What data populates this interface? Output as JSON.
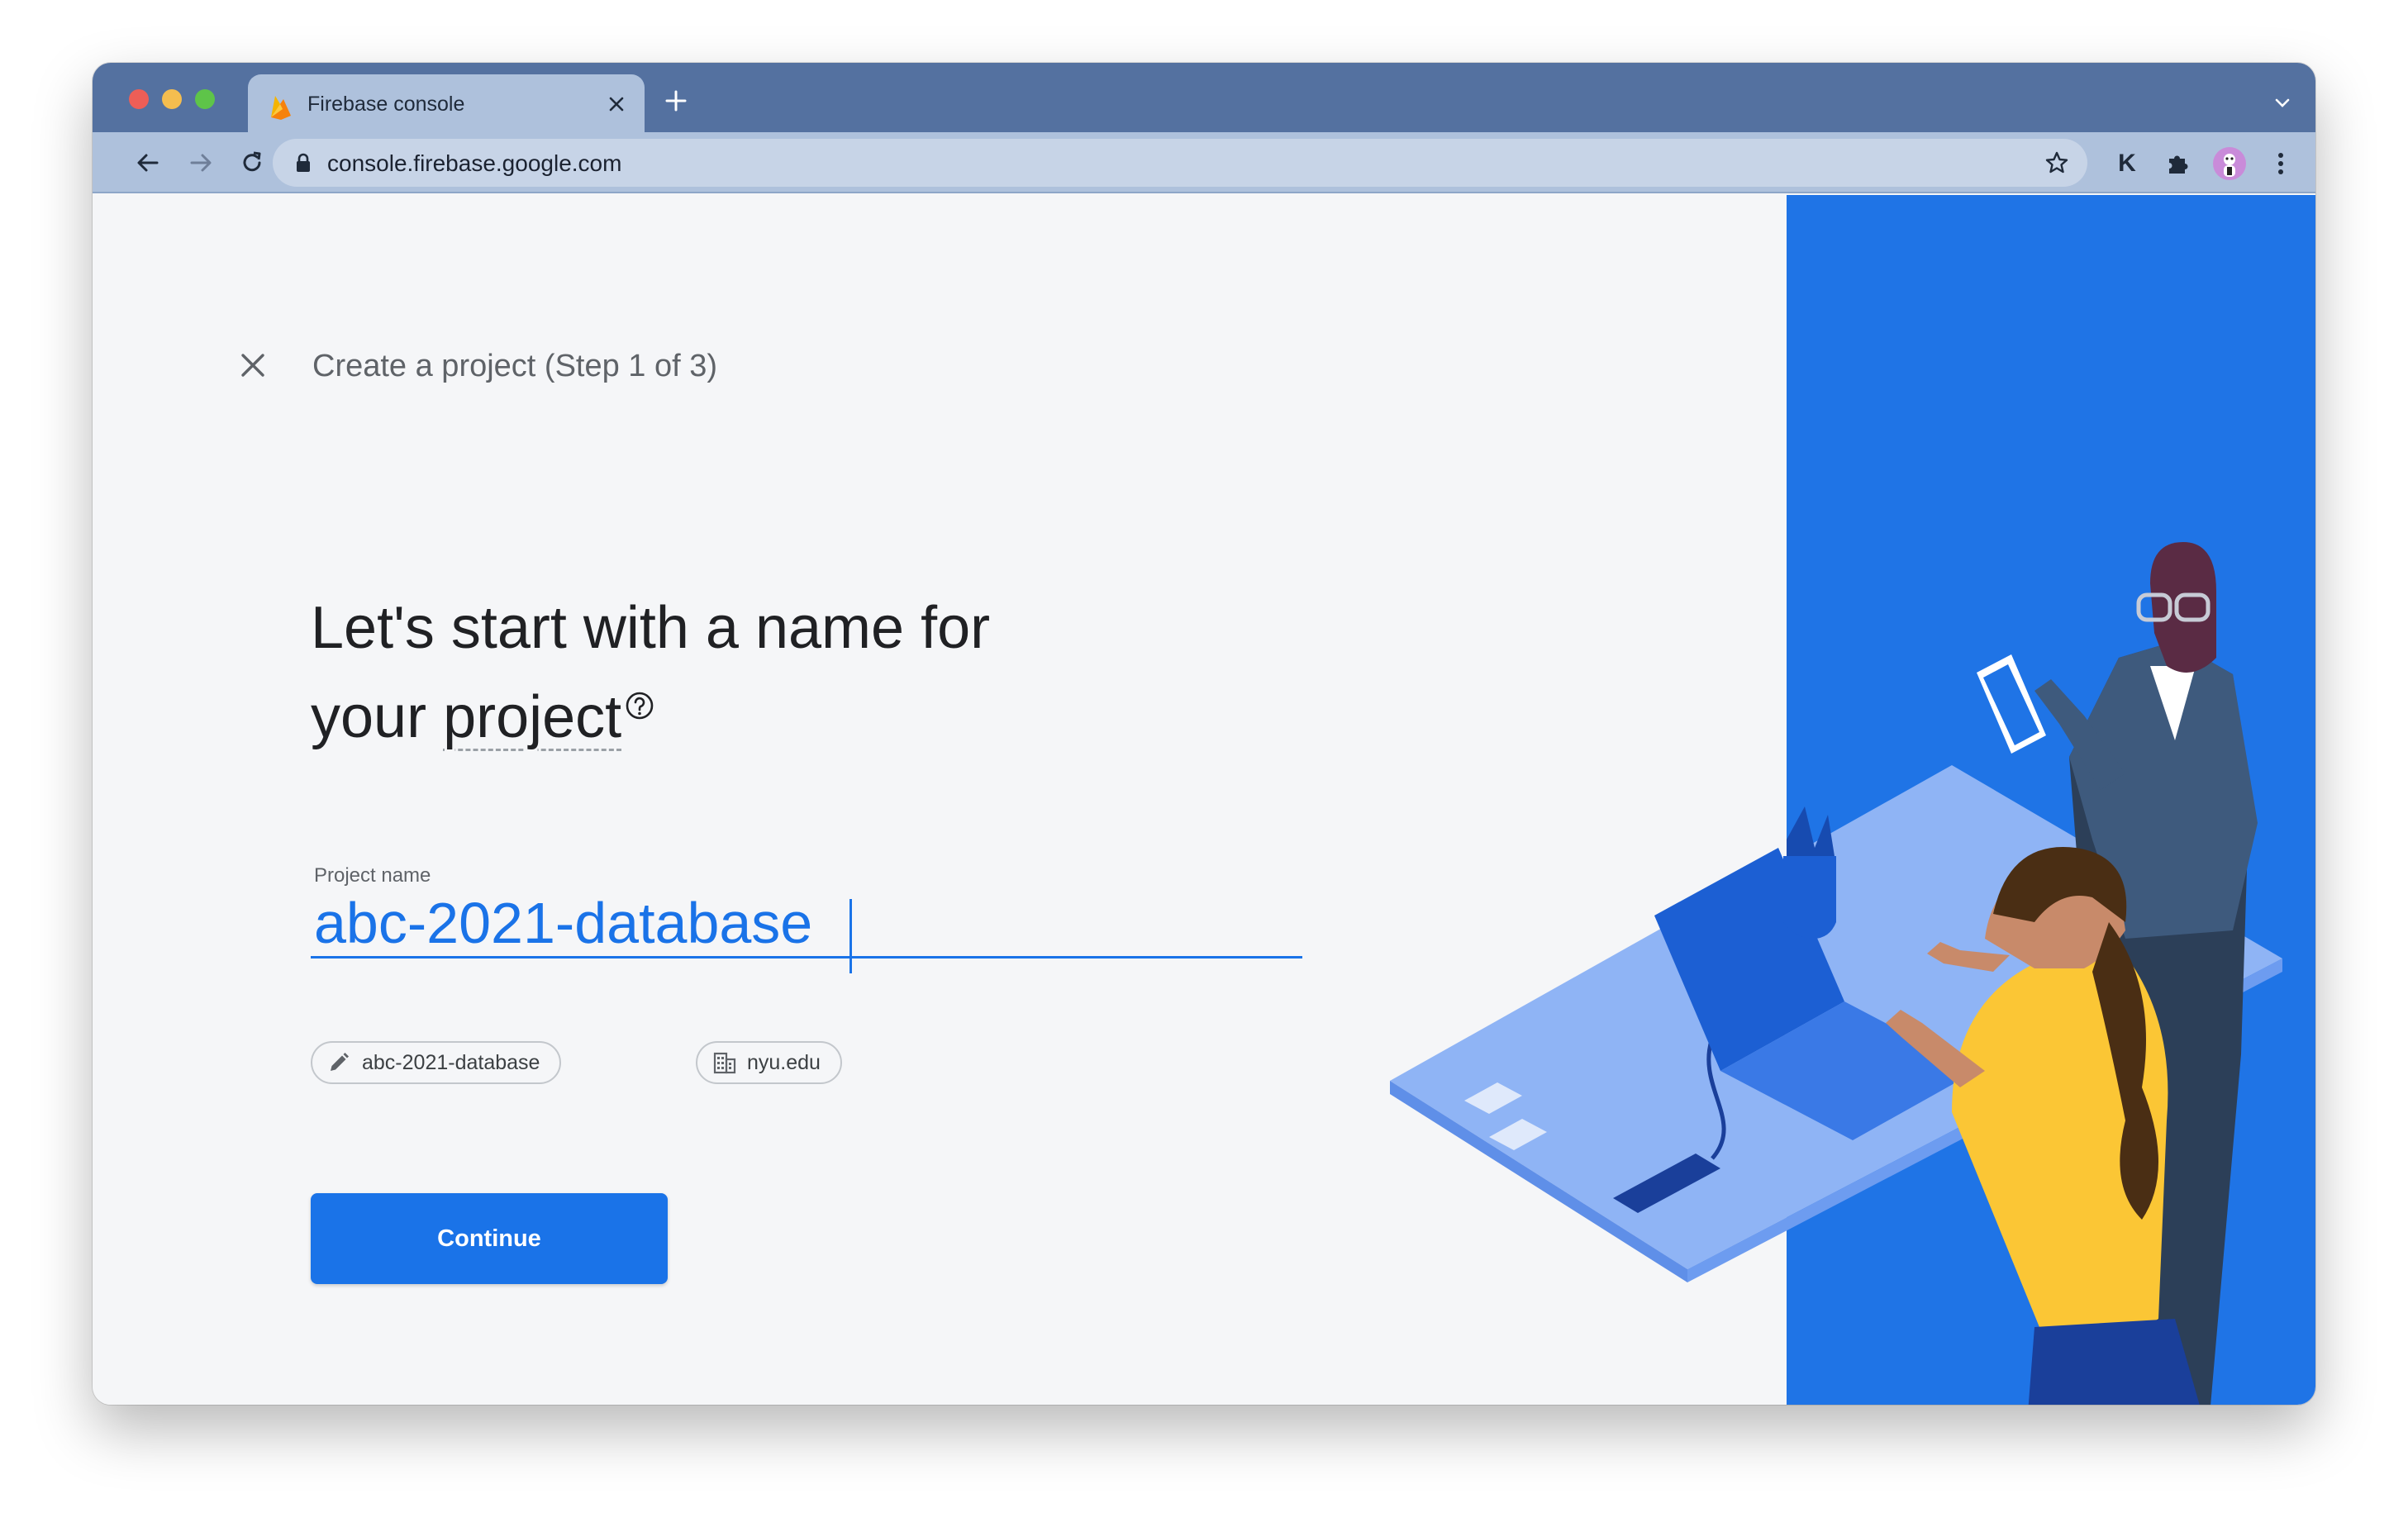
{
  "browser": {
    "tab_title": "Firebase console",
    "url": "console.firebase.google.com",
    "extension_letter": "K",
    "colors": {
      "tabstrip": "#5471a0",
      "toolbar": "#aec1dc"
    }
  },
  "page": {
    "step_title": "Create a project (Step 1 of 3)",
    "heading_line1": "Let's start with a name for",
    "heading_line2_prefix": "your ",
    "heading_line2_term": "project",
    "field_label": "Project name",
    "field_value": "abc-2021-database",
    "chips": [
      {
        "label": "abc-2021-database",
        "icon": "pencil-icon"
      },
      {
        "label": "nyu.edu",
        "icon": "building-icon"
      }
    ],
    "continue_label": "Continue",
    "colors": {
      "accent": "#1a73e8",
      "panel_blue": "#1f74e6"
    }
  }
}
